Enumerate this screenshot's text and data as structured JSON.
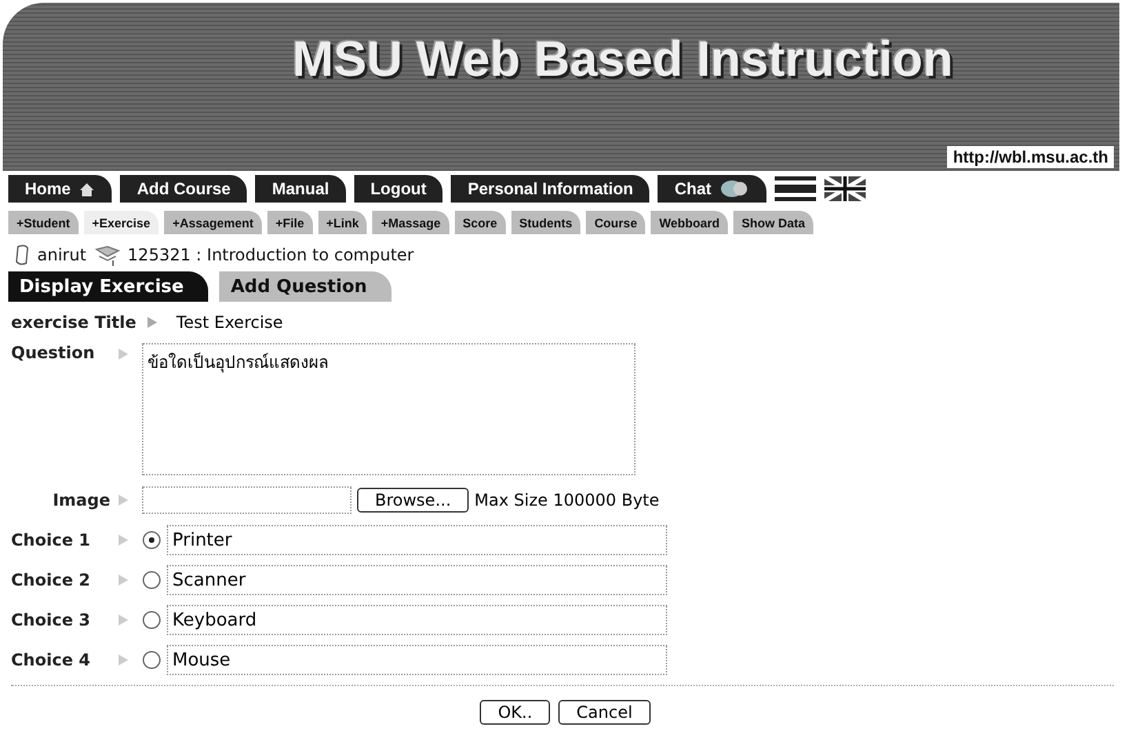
{
  "banner": {
    "title": "MSU  Web Based Instruction",
    "url": "http://wbl.msu.ac.th"
  },
  "nav": [
    {
      "label": "Home"
    },
    {
      "label": "Add Course"
    },
    {
      "label": "Manual"
    },
    {
      "label": "Logout"
    },
    {
      "label": "Personal Information"
    },
    {
      "label": "Chat"
    }
  ],
  "subtabs": [
    {
      "label": "+Student",
      "selected": false
    },
    {
      "label": "+Exercise",
      "selected": true
    },
    {
      "label": "+Assagement",
      "selected": false
    },
    {
      "label": "+File",
      "selected": false
    },
    {
      "label": "+Link",
      "selected": false
    },
    {
      "label": "+Massage",
      "selected": false
    },
    {
      "label": "Score",
      "selected": false
    },
    {
      "label": "Students",
      "selected": false
    },
    {
      "label": "Course",
      "selected": false
    },
    {
      "label": "Webboard",
      "selected": false
    },
    {
      "label": "Show Data",
      "selected": false
    }
  ],
  "user": {
    "name": "anirut",
    "course": "125321 : Introduction to computer"
  },
  "tabs": [
    {
      "label": "Display Exercise",
      "selected": true
    },
    {
      "label": "Add Question",
      "selected": false
    }
  ],
  "exercise_title": {
    "label": "exercise Title",
    "value": "Test Exercise"
  },
  "question": {
    "label": "Question",
    "value": "ข้อใดเป็นอุปกรณ์แสดงผล"
  },
  "image": {
    "label": "Image",
    "button": "Browse...",
    "note": "Max Size 100000 Byte"
  },
  "choices": [
    {
      "label": "Choice 1",
      "value": "Printer",
      "selected": true
    },
    {
      "label": "Choice 2",
      "value": "Scanner",
      "selected": false
    },
    {
      "label": "Choice 3",
      "value": "Keyboard",
      "selected": false
    },
    {
      "label": "Choice 4",
      "value": "Mouse",
      "selected": false
    }
  ],
  "buttons": [
    "OK..",
    "Cancel"
  ]
}
